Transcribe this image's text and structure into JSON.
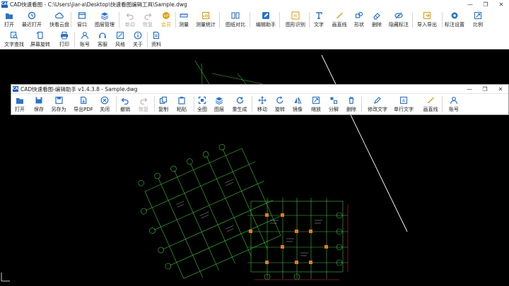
{
  "main_window": {
    "title": "CAD快速看图 - C:\\Users\\jiar-a\\Desktop\\快速看图编辑工具\\Sample.dwg",
    "logo_text": "CAD",
    "controls": {
      "minimize": "—",
      "maximize": "❐",
      "close": "✕"
    }
  },
  "main_toolbar": {
    "row1": [
      {
        "label": "打开",
        "icon": "folder-open-icon"
      },
      {
        "label": "最近打开",
        "icon": "clock-icon"
      },
      {
        "label": "快看云盘",
        "icon": "cloud-icon"
      },
      {
        "label": "窗口",
        "icon": "window-icon"
      },
      {
        "label": "图层管理",
        "icon": "layers-icon"
      },
      {
        "label": "新动",
        "icon": "undo-icon",
        "disabled": true
      },
      {
        "label": "恢复",
        "icon": "redo-icon",
        "disabled": true
      },
      {
        "label": "会员",
        "icon": "vip-icon",
        "vip": true
      },
      {
        "label": "测量",
        "icon": "ruler-icon"
      },
      {
        "label": "测量统计",
        "icon": "measure-stats-icon"
      },
      {
        "label": "图纸对比",
        "icon": "compare-icon"
      },
      {
        "label": "编辑助手",
        "icon": "edit-assistant-icon"
      },
      {
        "label": "图形识别",
        "icon": "shape-recognize-icon"
      },
      {
        "label": "文字",
        "icon": "text-icon"
      },
      {
        "label": "画直线",
        "icon": "line-icon"
      },
      {
        "label": "形状",
        "icon": "shape-icon"
      },
      {
        "label": "删除",
        "icon": "eraser-icon"
      },
      {
        "label": "隐藏标注",
        "icon": "hide-annotation-icon"
      },
      {
        "label": "导入导出",
        "icon": "import-export-icon"
      },
      {
        "label": "标注设置",
        "icon": "annotation-settings-icon"
      },
      {
        "label": "比例",
        "icon": "scale-icon"
      }
    ],
    "row2": [
      {
        "label": "文字查找",
        "icon": "text-search-icon"
      },
      {
        "label": "屏幕旋转",
        "icon": "rotate-screen-icon"
      },
      {
        "label": "打印",
        "icon": "printer-icon"
      },
      {
        "label": "账号",
        "icon": "user-icon"
      },
      {
        "label": "客服",
        "icon": "headset-icon"
      },
      {
        "label": "风格",
        "icon": "style-icon"
      },
      {
        "label": "关于",
        "icon": "info-icon"
      },
      {
        "label": "资料",
        "icon": "document-icon"
      }
    ]
  },
  "helper_window": {
    "title": "CAD快速看图-编辑助手 v1.4.3.8 - Sample.dwg",
    "logo_text": "CAD",
    "controls": {
      "minimize": "—",
      "maximize": "❐",
      "close": "✕"
    },
    "tools": [
      {
        "label": "打开",
        "icon": "folder-open-icon"
      },
      {
        "label": "保存",
        "icon": "save-icon"
      },
      {
        "label": "另存为",
        "icon": "save-as-icon"
      },
      {
        "label": "导出PDF",
        "icon": "pdf-export-icon"
      },
      {
        "label": "关闭",
        "icon": "close-circle-icon"
      },
      {
        "label": "撤销",
        "icon": "undo-icon"
      },
      {
        "label": "恢复",
        "icon": "redo-icon",
        "disabled": true
      },
      {
        "label": "复制",
        "icon": "copy-icon"
      },
      {
        "label": "粘贴",
        "icon": "paste-icon"
      },
      {
        "label": "全图",
        "icon": "fit-all-icon"
      },
      {
        "label": "图层",
        "icon": "layers-icon"
      },
      {
        "label": "重生成",
        "icon": "regenerate-icon"
      },
      {
        "label": "移动",
        "icon": "move-icon"
      },
      {
        "label": "旋转",
        "icon": "rotate-icon"
      },
      {
        "label": "镜像",
        "icon": "mirror-icon"
      },
      {
        "label": "缩放",
        "icon": "scale-icon"
      },
      {
        "label": "分解",
        "icon": "explode-icon"
      },
      {
        "label": "删除",
        "icon": "trash-icon"
      },
      {
        "label": "修改文字",
        "icon": "edit-text-icon"
      },
      {
        "label": "单行文字",
        "icon": "single-line-text-icon"
      },
      {
        "label": "画直线",
        "icon": "line-icon"
      },
      {
        "label": "账号",
        "icon": "user-icon"
      }
    ]
  },
  "colors": {
    "accent": "#1e5fb8",
    "canvas": "#000000",
    "vip": "#d8a21a"
  }
}
